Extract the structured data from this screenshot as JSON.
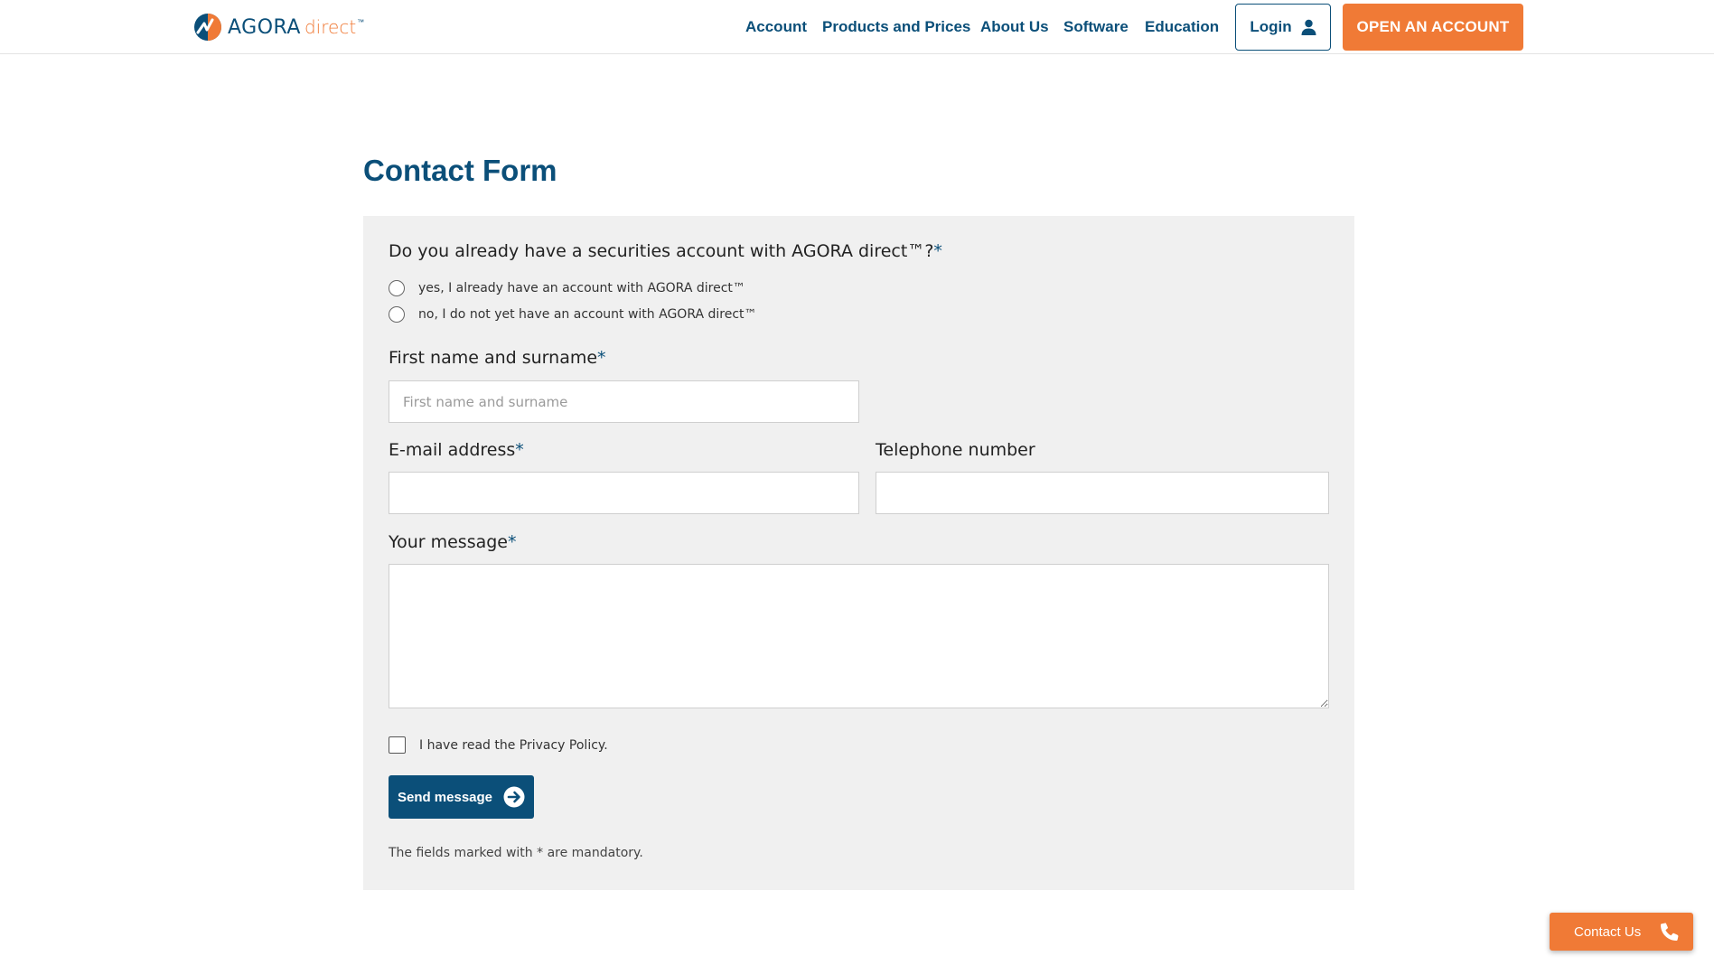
{
  "brand": {
    "name": "AGORA",
    "suffix": "direct",
    "tm": "™",
    "accent": "#f07a36",
    "primary": "#0b4f79"
  },
  "nav": {
    "items": [
      {
        "label": "Account"
      },
      {
        "label": "Products and Prices"
      },
      {
        "label": "About Us"
      },
      {
        "label": "Software"
      },
      {
        "label": "Education"
      }
    ],
    "login_label": "Login",
    "login_icon": "user-icon",
    "open_account_label": "OPEN AN ACCOUNT"
  },
  "page": {
    "title": "Contact Form"
  },
  "form": {
    "account_question": "Do you already have a securities account with AGORA direct™?",
    "required_marker": "*",
    "options": [
      {
        "label": "yes, I already have an account with AGORA direct™",
        "selected": false
      },
      {
        "label": "no, I do not yet have an account with AGORA direct™",
        "selected": false
      }
    ],
    "name_label": "First name and surname",
    "name_placeholder": "First name and surname",
    "name_value": "",
    "email_label": "E-mail address",
    "email_value": "",
    "phone_label": "Telephone number",
    "phone_value": "",
    "message_label": "Your message",
    "message_value": "",
    "privacy_label": "I have read the Privacy Policy.",
    "privacy_checked": false,
    "send_label": "Send message",
    "send_icon": "arrow-right-circle-icon",
    "mandatory_note": "The fields marked with * are mandatory."
  },
  "floating": {
    "contact_label": "Contact Us",
    "contact_icon": "phone-icon"
  }
}
